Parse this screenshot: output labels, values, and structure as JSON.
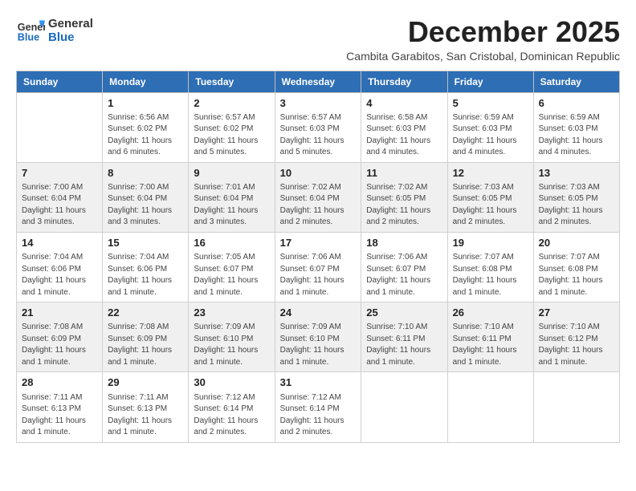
{
  "logo": {
    "general": "General",
    "blue": "Blue"
  },
  "title": "December 2025",
  "location": "Cambita Garabitos, San Cristobal, Dominican Republic",
  "weekdays": [
    "Sunday",
    "Monday",
    "Tuesday",
    "Wednesday",
    "Thursday",
    "Friday",
    "Saturday"
  ],
  "weeks": [
    [
      {
        "day": "",
        "info": ""
      },
      {
        "day": "1",
        "info": "Sunrise: 6:56 AM\nSunset: 6:02 PM\nDaylight: 11 hours\nand 6 minutes."
      },
      {
        "day": "2",
        "info": "Sunrise: 6:57 AM\nSunset: 6:02 PM\nDaylight: 11 hours\nand 5 minutes."
      },
      {
        "day": "3",
        "info": "Sunrise: 6:57 AM\nSunset: 6:03 PM\nDaylight: 11 hours\nand 5 minutes."
      },
      {
        "day": "4",
        "info": "Sunrise: 6:58 AM\nSunset: 6:03 PM\nDaylight: 11 hours\nand 4 minutes."
      },
      {
        "day": "5",
        "info": "Sunrise: 6:59 AM\nSunset: 6:03 PM\nDaylight: 11 hours\nand 4 minutes."
      },
      {
        "day": "6",
        "info": "Sunrise: 6:59 AM\nSunset: 6:03 PM\nDaylight: 11 hours\nand 4 minutes."
      }
    ],
    [
      {
        "day": "7",
        "info": "Sunrise: 7:00 AM\nSunset: 6:04 PM\nDaylight: 11 hours\nand 3 minutes."
      },
      {
        "day": "8",
        "info": "Sunrise: 7:00 AM\nSunset: 6:04 PM\nDaylight: 11 hours\nand 3 minutes."
      },
      {
        "day": "9",
        "info": "Sunrise: 7:01 AM\nSunset: 6:04 PM\nDaylight: 11 hours\nand 3 minutes."
      },
      {
        "day": "10",
        "info": "Sunrise: 7:02 AM\nSunset: 6:04 PM\nDaylight: 11 hours\nand 2 minutes."
      },
      {
        "day": "11",
        "info": "Sunrise: 7:02 AM\nSunset: 6:05 PM\nDaylight: 11 hours\nand 2 minutes."
      },
      {
        "day": "12",
        "info": "Sunrise: 7:03 AM\nSunset: 6:05 PM\nDaylight: 11 hours\nand 2 minutes."
      },
      {
        "day": "13",
        "info": "Sunrise: 7:03 AM\nSunset: 6:05 PM\nDaylight: 11 hours\nand 2 minutes."
      }
    ],
    [
      {
        "day": "14",
        "info": "Sunrise: 7:04 AM\nSunset: 6:06 PM\nDaylight: 11 hours\nand 1 minute."
      },
      {
        "day": "15",
        "info": "Sunrise: 7:04 AM\nSunset: 6:06 PM\nDaylight: 11 hours\nand 1 minute."
      },
      {
        "day": "16",
        "info": "Sunrise: 7:05 AM\nSunset: 6:07 PM\nDaylight: 11 hours\nand 1 minute."
      },
      {
        "day": "17",
        "info": "Sunrise: 7:06 AM\nSunset: 6:07 PM\nDaylight: 11 hours\nand 1 minute."
      },
      {
        "day": "18",
        "info": "Sunrise: 7:06 AM\nSunset: 6:07 PM\nDaylight: 11 hours\nand 1 minute."
      },
      {
        "day": "19",
        "info": "Sunrise: 7:07 AM\nSunset: 6:08 PM\nDaylight: 11 hours\nand 1 minute."
      },
      {
        "day": "20",
        "info": "Sunrise: 7:07 AM\nSunset: 6:08 PM\nDaylight: 11 hours\nand 1 minute."
      }
    ],
    [
      {
        "day": "21",
        "info": "Sunrise: 7:08 AM\nSunset: 6:09 PM\nDaylight: 11 hours\nand 1 minute."
      },
      {
        "day": "22",
        "info": "Sunrise: 7:08 AM\nSunset: 6:09 PM\nDaylight: 11 hours\nand 1 minute."
      },
      {
        "day": "23",
        "info": "Sunrise: 7:09 AM\nSunset: 6:10 PM\nDaylight: 11 hours\nand 1 minute."
      },
      {
        "day": "24",
        "info": "Sunrise: 7:09 AM\nSunset: 6:10 PM\nDaylight: 11 hours\nand 1 minute."
      },
      {
        "day": "25",
        "info": "Sunrise: 7:10 AM\nSunset: 6:11 PM\nDaylight: 11 hours\nand 1 minute."
      },
      {
        "day": "26",
        "info": "Sunrise: 7:10 AM\nSunset: 6:11 PM\nDaylight: 11 hours\nand 1 minute."
      },
      {
        "day": "27",
        "info": "Sunrise: 7:10 AM\nSunset: 6:12 PM\nDaylight: 11 hours\nand 1 minute."
      }
    ],
    [
      {
        "day": "28",
        "info": "Sunrise: 7:11 AM\nSunset: 6:13 PM\nDaylight: 11 hours\nand 1 minute."
      },
      {
        "day": "29",
        "info": "Sunrise: 7:11 AM\nSunset: 6:13 PM\nDaylight: 11 hours\nand 1 minute."
      },
      {
        "day": "30",
        "info": "Sunrise: 7:12 AM\nSunset: 6:14 PM\nDaylight: 11 hours\nand 2 minutes."
      },
      {
        "day": "31",
        "info": "Sunrise: 7:12 AM\nSunset: 6:14 PM\nDaylight: 11 hours\nand 2 minutes."
      },
      {
        "day": "",
        "info": ""
      },
      {
        "day": "",
        "info": ""
      },
      {
        "day": "",
        "info": ""
      }
    ]
  ]
}
